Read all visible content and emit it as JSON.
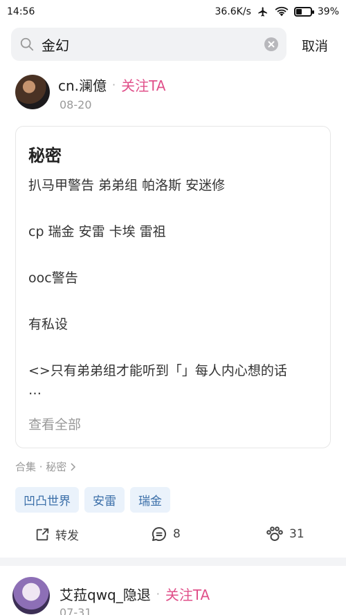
{
  "status": {
    "time": "14:56",
    "speed": "36.6K/s",
    "battery": "39%",
    "battery_level": 0.39
  },
  "search": {
    "query": "金幻",
    "cancel": "取消"
  },
  "post": {
    "author": "cn.澜億",
    "separator": "·",
    "follow": "关注TA",
    "date": "08-20",
    "title": "秘密",
    "lines": [
      "扒马甲警告 弟弟组 帕洛斯 安迷修",
      "cp 瑞金 安雷 卡埃 雷祖",
      "ooc警告",
      "有私设",
      "<>只有弟弟组才能听到「」每人内心想的话"
    ],
    "ellipsis": "…",
    "see_all": "查看全部",
    "collection": "合集 · 秘密",
    "tags": [
      "凹凸世界",
      "安雷",
      "瑞金"
    ],
    "actions": {
      "repost": "转发",
      "comments": "8",
      "likes": "31"
    }
  },
  "post2": {
    "author": "艾菈qwq_隐退",
    "separator": "·",
    "follow": "关注TA",
    "date": "07-31"
  },
  "colors": {
    "follow": "#e0508a",
    "tag_bg": "#eaf2fb",
    "tag_text": "#3a6ea8",
    "muted": "#999999"
  }
}
